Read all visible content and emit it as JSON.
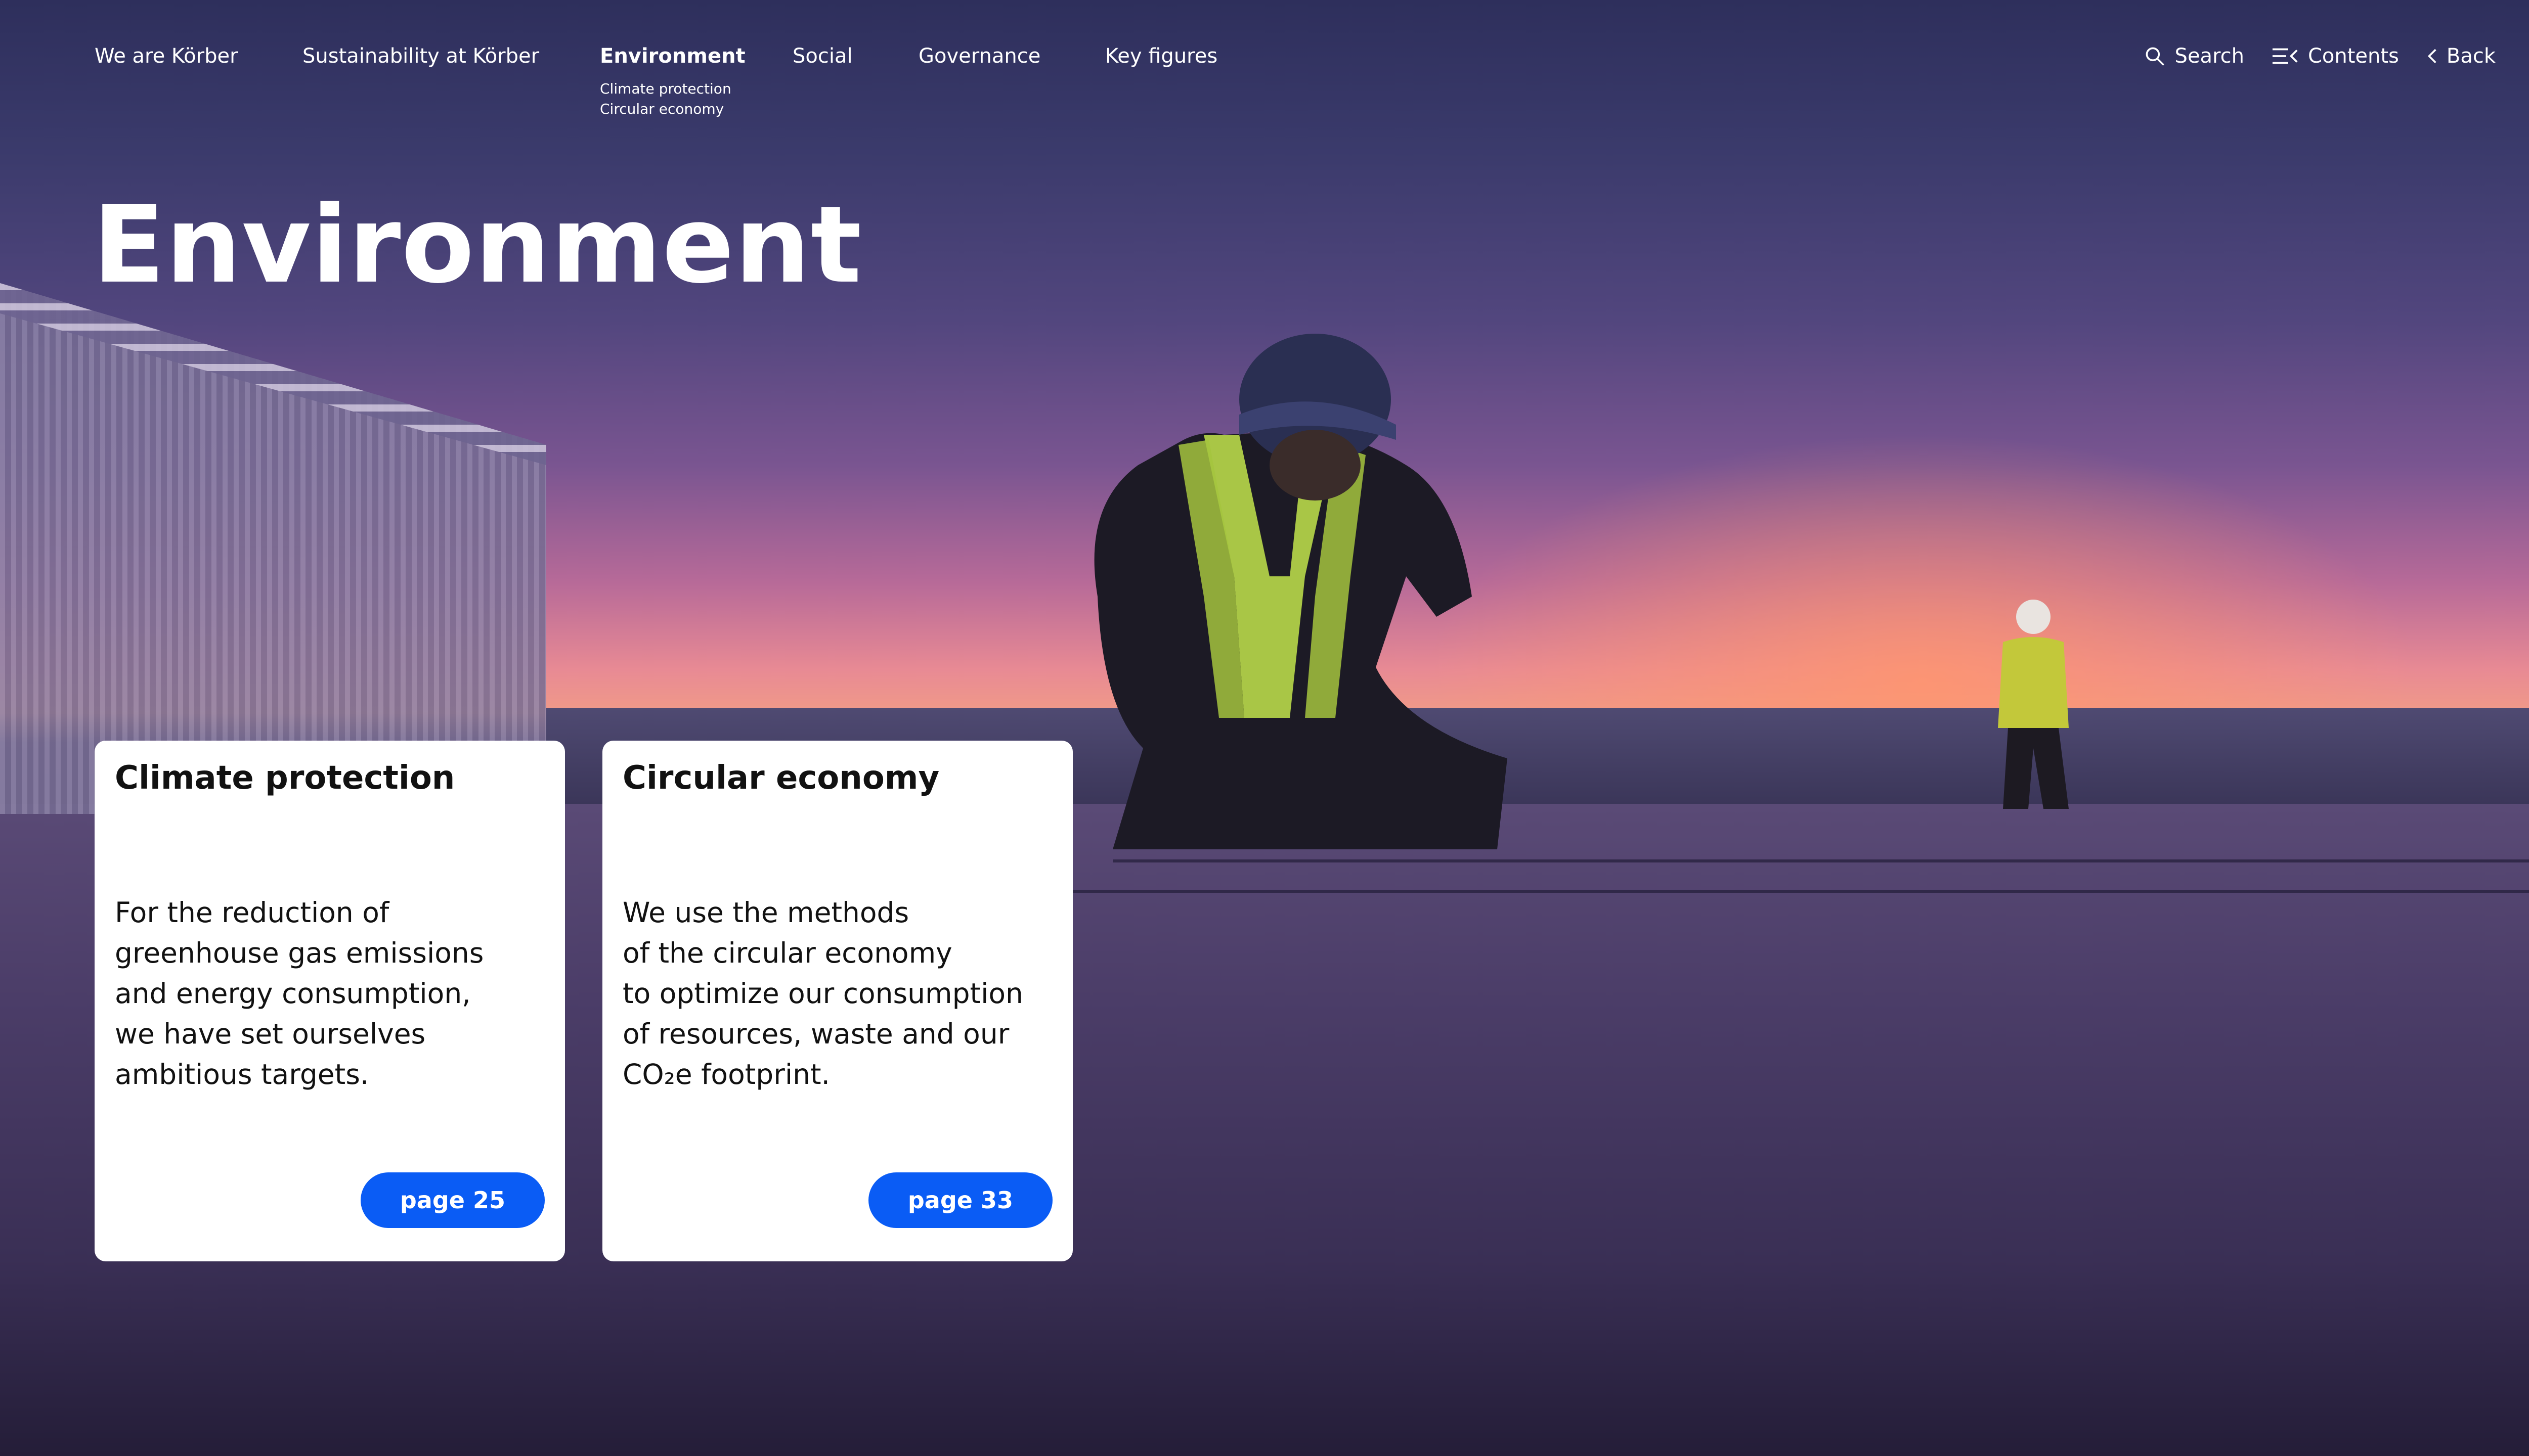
{
  "nav": {
    "items": [
      {
        "label": "We are Körber"
      },
      {
        "label": "Sustainability at Körber"
      },
      {
        "label": "Environment",
        "sub": [
          "Climate protection",
          "Circular economy"
        ]
      },
      {
        "label": "Social"
      },
      {
        "label": "Governance"
      },
      {
        "label": "Key figures"
      }
    ]
  },
  "tools": {
    "search": "Search",
    "contents": "Contents",
    "back": "Back"
  },
  "page": {
    "title": "Environment"
  },
  "cards": [
    {
      "title": "Climate protection",
      "text": "For the reduction of\ngreenhouse gas emissions\nand energy consumption,\nwe have set ourselves\nambitious targets.",
      "button": "page 25"
    },
    {
      "title": "Circular economy",
      "text": "We use the methods\nof the circular economy\nto optimize our consumption\nof resources, waste and our\nCO₂e footprint.",
      "button": "page 33"
    }
  ],
  "colors": {
    "accent": "#0a5cf5",
    "card_bg": "#ffffff"
  }
}
